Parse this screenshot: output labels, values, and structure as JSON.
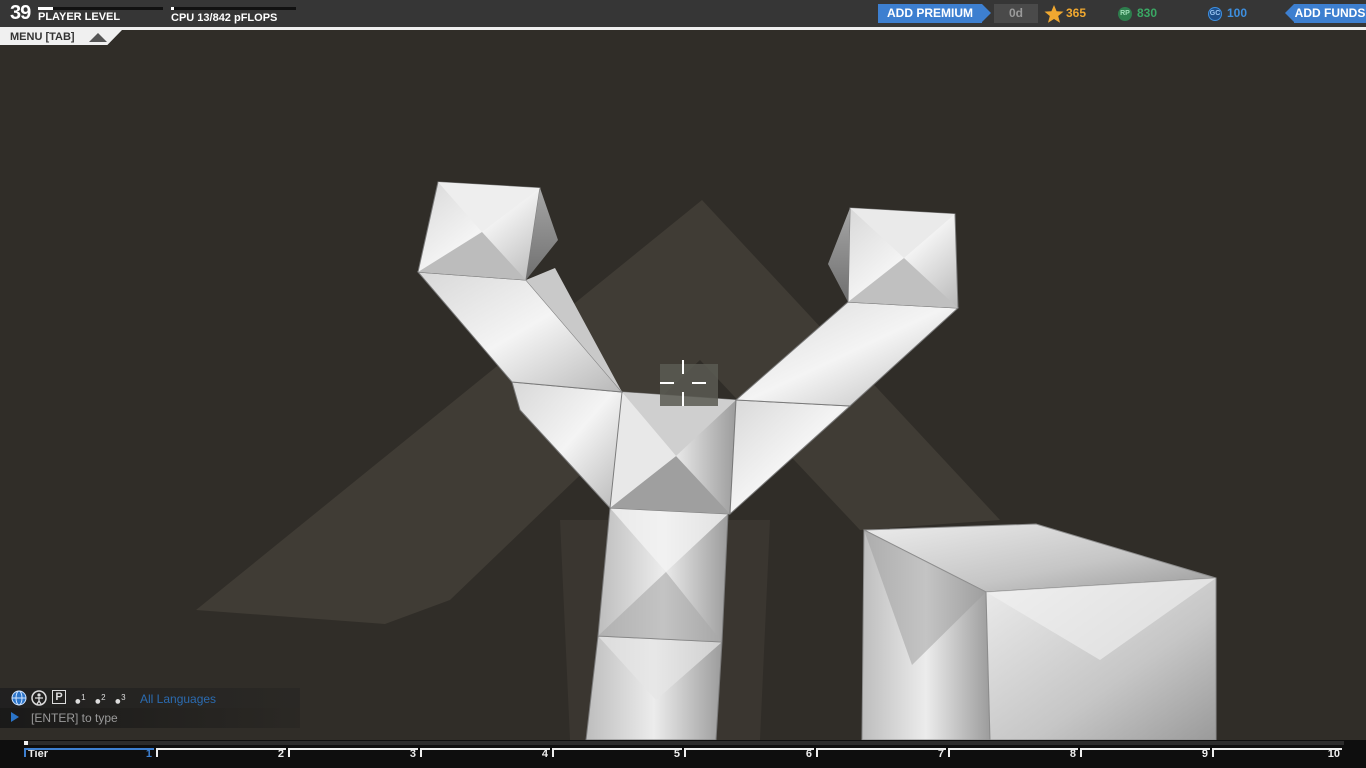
{
  "player": {
    "level": "39",
    "level_label": "PLAYER LEVEL",
    "level_progress": 0.12
  },
  "cpu": {
    "label": "CPU 13/842 pFLOPS",
    "used": 13,
    "max": 842
  },
  "premium": {
    "button_label": "ADD PREMIUM",
    "days": "0d"
  },
  "currencies": [
    {
      "icon": "star-icon",
      "value": "365",
      "color": "#f0a830"
    },
    {
      "icon": "robits-icon",
      "icon_text": "RP",
      "value": "830",
      "color": "#3aa864"
    },
    {
      "icon": "galaxy-coins-icon",
      "icon_text": "GC",
      "value": "100",
      "color": "#3d8fe0"
    }
  ],
  "funds": {
    "button_label": "ADD FUNDS"
  },
  "menu": {
    "label": "MENU [TAB]"
  },
  "chat": {
    "channels": [
      "globe-icon",
      "faction-icon",
      "party-icon",
      "team-1-icon",
      "team-2-icon",
      "team-3-icon"
    ],
    "channel_texts": [
      "",
      "",
      "P",
      "1",
      "2",
      "3"
    ],
    "language": "All Languages",
    "placeholder": "[ENTER] to type"
  },
  "tiers": {
    "label": "Tier",
    "numbers": [
      "1",
      "2",
      "3",
      "4",
      "5",
      "6",
      "7",
      "8",
      "9",
      "10"
    ],
    "progress": 0.003
  },
  "colors": {
    "accent": "#3d7fd0",
    "background": "#302d28",
    "topbar": "#363636"
  }
}
